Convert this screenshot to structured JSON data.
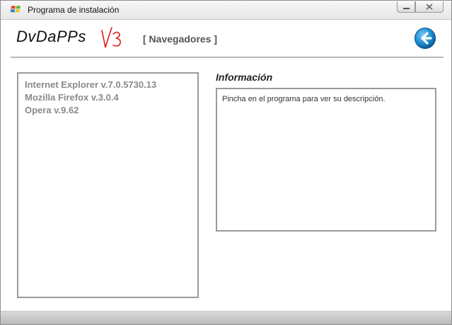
{
  "window": {
    "title": "Programa de instalación",
    "icon": "windows-flag-icon"
  },
  "header": {
    "logo": "DvDaPPs",
    "version_mark": "v3",
    "section": "[ Navegadores ]",
    "back_icon": "back-arrow-icon"
  },
  "programs": {
    "items": [
      "Internet Explorer v.7.0.5730.13",
      "Mozilla Firefox v.3.0.4",
      "Opera v.9.62"
    ]
  },
  "info": {
    "heading": "Información",
    "description": "Pincha en el programa para ver su descripción."
  },
  "colors": {
    "accent": "#1e90d6",
    "version_mark": "#e01818",
    "list_text": "#8a8a8a"
  }
}
